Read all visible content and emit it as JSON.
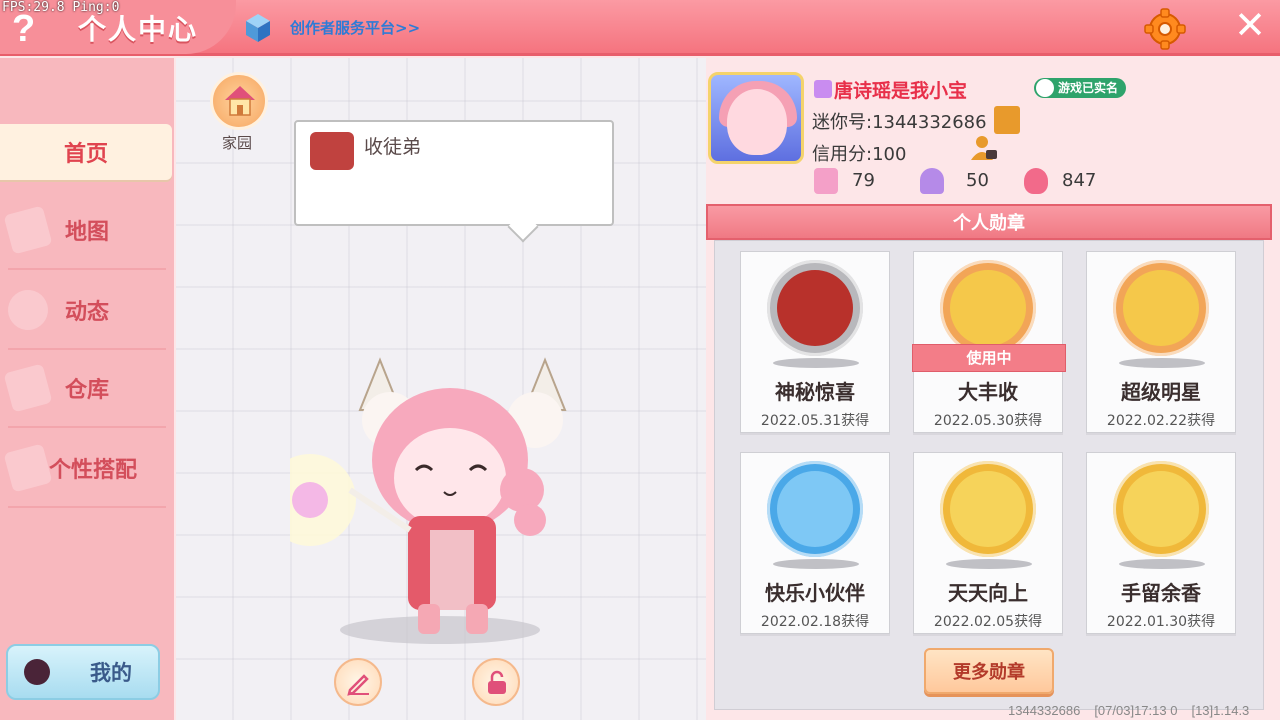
{
  "debug": {
    "fps_ping": "FPS:29.8  Ping:0"
  },
  "header": {
    "help_icon": "?",
    "title": "个人中心",
    "creator_link": "创作者服务平台>>",
    "close_icon": "✕"
  },
  "sidebar": {
    "items": [
      {
        "label": "首页",
        "active": true
      },
      {
        "label": "地图"
      },
      {
        "label": "动态"
      },
      {
        "label": "仓库"
      },
      {
        "label": "个性搭配"
      }
    ],
    "my_button": "我的"
  },
  "center": {
    "home_label": "家园",
    "bubble_text": "收徒弟"
  },
  "profile": {
    "nickname": "唐诗瑶是我小宝",
    "realname_badge": "游戏已实名",
    "uid": "迷你号:1344332686",
    "credit": "信用分:100",
    "stats": [
      "79",
      "50",
      "847"
    ]
  },
  "medals": {
    "header": "个人勋章",
    "items": [
      {
        "name": "神秘惊喜",
        "date": "2022.05.31获得",
        "ring": "#b8b8bc",
        "inner": "#b8312b"
      },
      {
        "name": "大丰收",
        "date": "2022.05.30获得",
        "ring": "#f2a557",
        "inner": "#f5c84a",
        "in_use": "使用中"
      },
      {
        "name": "超级明星",
        "date": "2022.02.22获得",
        "ring": "#f2a557",
        "inner": "#f5c84a"
      },
      {
        "name": "快乐小伙伴",
        "date": "2022.02.18获得",
        "ring": "#4aa8e8",
        "inner": "#7ec8f5"
      },
      {
        "name": "天天向上",
        "date": "2022.02.05获得",
        "ring": "#f0b83a",
        "inner": "#f6d35a"
      },
      {
        "name": "手留余香",
        "date": "2022.01.30获得",
        "ring": "#f0b83a",
        "inner": "#f6d35a"
      }
    ],
    "more_button": "更多勋章"
  },
  "footer": {
    "uid": "1344332686",
    "timestamp": "[07/03]17:13 0",
    "version": "[13]1.14.3"
  }
}
